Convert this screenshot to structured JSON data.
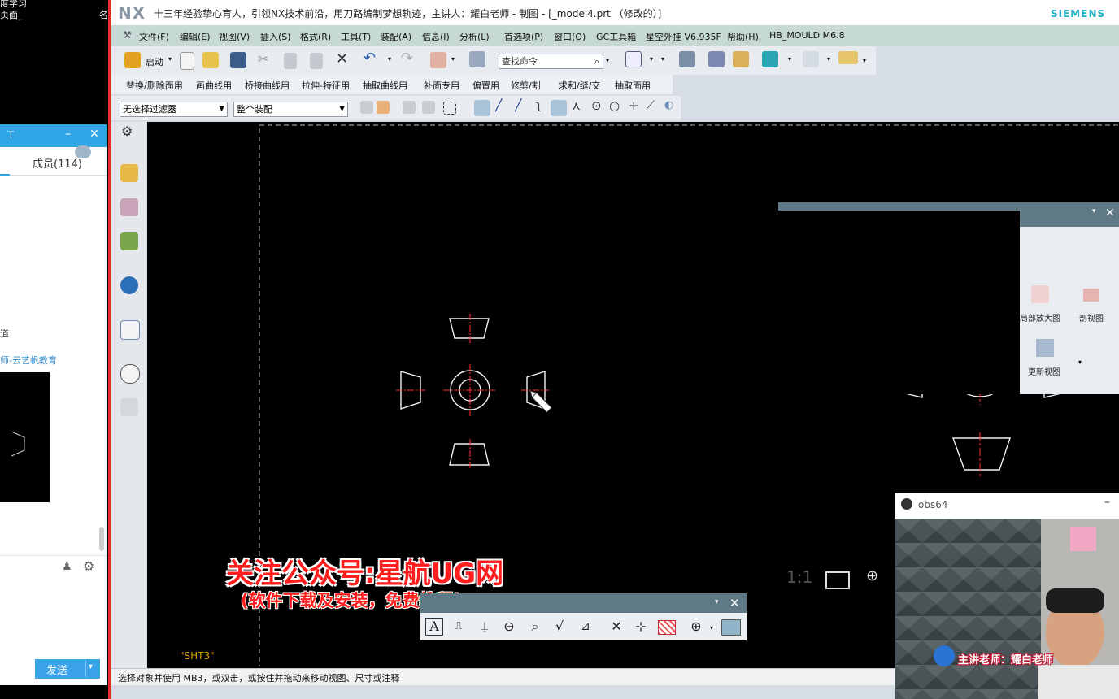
{
  "left_panel": {
    "top_text_1": "度学习",
    "top_text_2": "页面_",
    "top_text_3": "名",
    "pin_icon": "pin-icon",
    "members_tab": "成员(114)",
    "message_1": "道",
    "message_2": "师-云艺帆教育",
    "send_label": "发送"
  },
  "nx": {
    "logo": "NX",
    "title": "十三年经验挚心育人，引领NX技术前沿，用刀路编制梦想轨迹，主讲人：耀白老师 - 制图 - [_model4.prt （修改的）]",
    "brand": "SIEMENS",
    "menu": [
      "文件(F)",
      "编辑(E)",
      "视图(V)",
      "插入(S)",
      "格式(R)",
      "工具(T)",
      "装配(A)",
      "信息(I)",
      "分析(L)",
      "首选项(P)",
      "窗口(O)",
      "GC工具箱",
      "星空外挂 V6.935F",
      "帮助(H)",
      "HB_MOULD M6.8"
    ],
    "start_label": "启动",
    "search_placeholder": "查找命令",
    "toolbar2": [
      "替换/删除面用",
      "画曲线用",
      "桥接曲线用",
      "拉伸-特征用",
      "抽取曲线用",
      "补面专用",
      "偏置用",
      "修剪/割",
      "求和/缝/交",
      "抽取面用"
    ],
    "filter_select": "无选择过滤器",
    "assembly_select": "整个装配",
    "sheet_label": "\"SHT3\"",
    "status": "选择对象并使用 MB3，或双击，或按住并拖动来移动视图、尺寸或注释",
    "scale": "1:1"
  },
  "ribbon_panel": {
    "detail_view": "局部放大图",
    "section_view": "剖视图",
    "update_view": "更新视图"
  },
  "overlay": {
    "line1": "关注公众号:星航UG网",
    "line2": "(软件下载及安装，免费教程)"
  },
  "obs": {
    "title": "obs64",
    "teacher_label": "主讲老师：耀白老师"
  }
}
